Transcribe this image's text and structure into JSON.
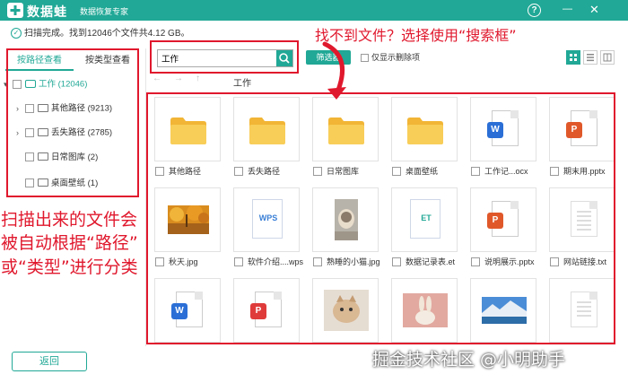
{
  "app": {
    "logo_text": "数据蛙",
    "subtitle": "数据恢复专家",
    "help_label": "?",
    "minimize_label": "—",
    "close_label": "✕"
  },
  "status": {
    "check_icon": "✓",
    "text": "扫描完成。找到12046个文件共4.12 GB。"
  },
  "sidebar": {
    "tabs": [
      "按路径查看",
      "按类型查看"
    ],
    "active_tab": 0,
    "tree": [
      {
        "label": "工作 (12046)",
        "expandable": true,
        "expanded": true,
        "level": 0
      },
      {
        "label": "其他路径 (9213)",
        "expandable": true,
        "expanded": false,
        "level": 1
      },
      {
        "label": "丢失路径 (2785)",
        "expandable": true,
        "expanded": false,
        "level": 1
      },
      {
        "label": "日常图库 (2)",
        "expandable": false,
        "expanded": false,
        "level": 1
      },
      {
        "label": "桌面壁纸 (1)",
        "expandable": false,
        "expanded": false,
        "level": 1
      }
    ],
    "back_button": "返回"
  },
  "toolbar": {
    "search_value": "工作",
    "filter_button": "筛选器",
    "only_deleted_label": "仅显示删除项",
    "nav_back": "←",
    "nav_forward": "→",
    "nav_up": "↑",
    "breadcrumb": "工作"
  },
  "files": [
    {
      "name": "其他路径",
      "type": "folder"
    },
    {
      "name": "丢失路径",
      "type": "folder"
    },
    {
      "name": "日常图库",
      "type": "folder"
    },
    {
      "name": "桌面壁纸",
      "type": "folder"
    },
    {
      "name": "工作记...ocx",
      "type": "word"
    },
    {
      "name": "期末用.pptx",
      "type": "ppt"
    },
    {
      "name": "秋天.jpg",
      "type": "image-autumn"
    },
    {
      "name": "软件介绍....wps",
      "type": "wps"
    },
    {
      "name": "熟睡的小猫.jpg",
      "type": "image-cat"
    },
    {
      "name": "数据记录表.et",
      "type": "et"
    },
    {
      "name": "说明展示.pptx",
      "type": "ppt"
    },
    {
      "name": "网站链接.txt",
      "type": "txt"
    },
    {
      "name": "",
      "type": "word"
    },
    {
      "name": "",
      "type": "pdf"
    },
    {
      "name": "",
      "type": "image-kitten"
    },
    {
      "name": "",
      "type": "image-rabbit"
    },
    {
      "name": "",
      "type": "image-lake"
    },
    {
      "name": "",
      "type": "txt"
    }
  ],
  "annotations": {
    "top": "找不到文件？选择使用“搜索框”",
    "left_lines": [
      "扫描出来的文件会",
      "被自动根据“路径”",
      "或“类型”进行分类"
    ]
  },
  "watermark": "掘金技术社区 @小明助手",
  "colors": {
    "accent": "#21a896",
    "annotation": "#e0182d",
    "word": "#2b6fd6",
    "ppt": "#e0582a",
    "pdf": "#e03b3b",
    "folder": "#f6c243"
  }
}
